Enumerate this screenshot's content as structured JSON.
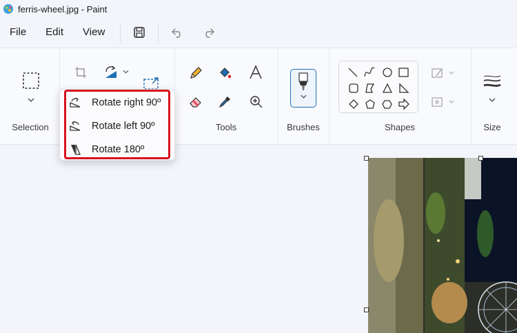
{
  "window": {
    "title": "ferris-wheel.jpg - Paint"
  },
  "menu": {
    "file": "File",
    "edit": "Edit",
    "view": "View"
  },
  "ribbon": {
    "groups": {
      "selection": "Selection",
      "tools": "Tools",
      "brushes": "Brushes",
      "shapes": "Shapes",
      "size": "Size"
    }
  },
  "rotate_menu": {
    "items": [
      {
        "label": "Rotate right 90º",
        "icon": "rotate-right-icon"
      },
      {
        "label": "Rotate left 90º",
        "icon": "rotate-left-icon"
      },
      {
        "label": "Rotate 180º",
        "icon": "rotate-180-icon"
      }
    ]
  },
  "colors": {
    "accent": "#1f6fb5",
    "highlight": "#d6111d"
  }
}
